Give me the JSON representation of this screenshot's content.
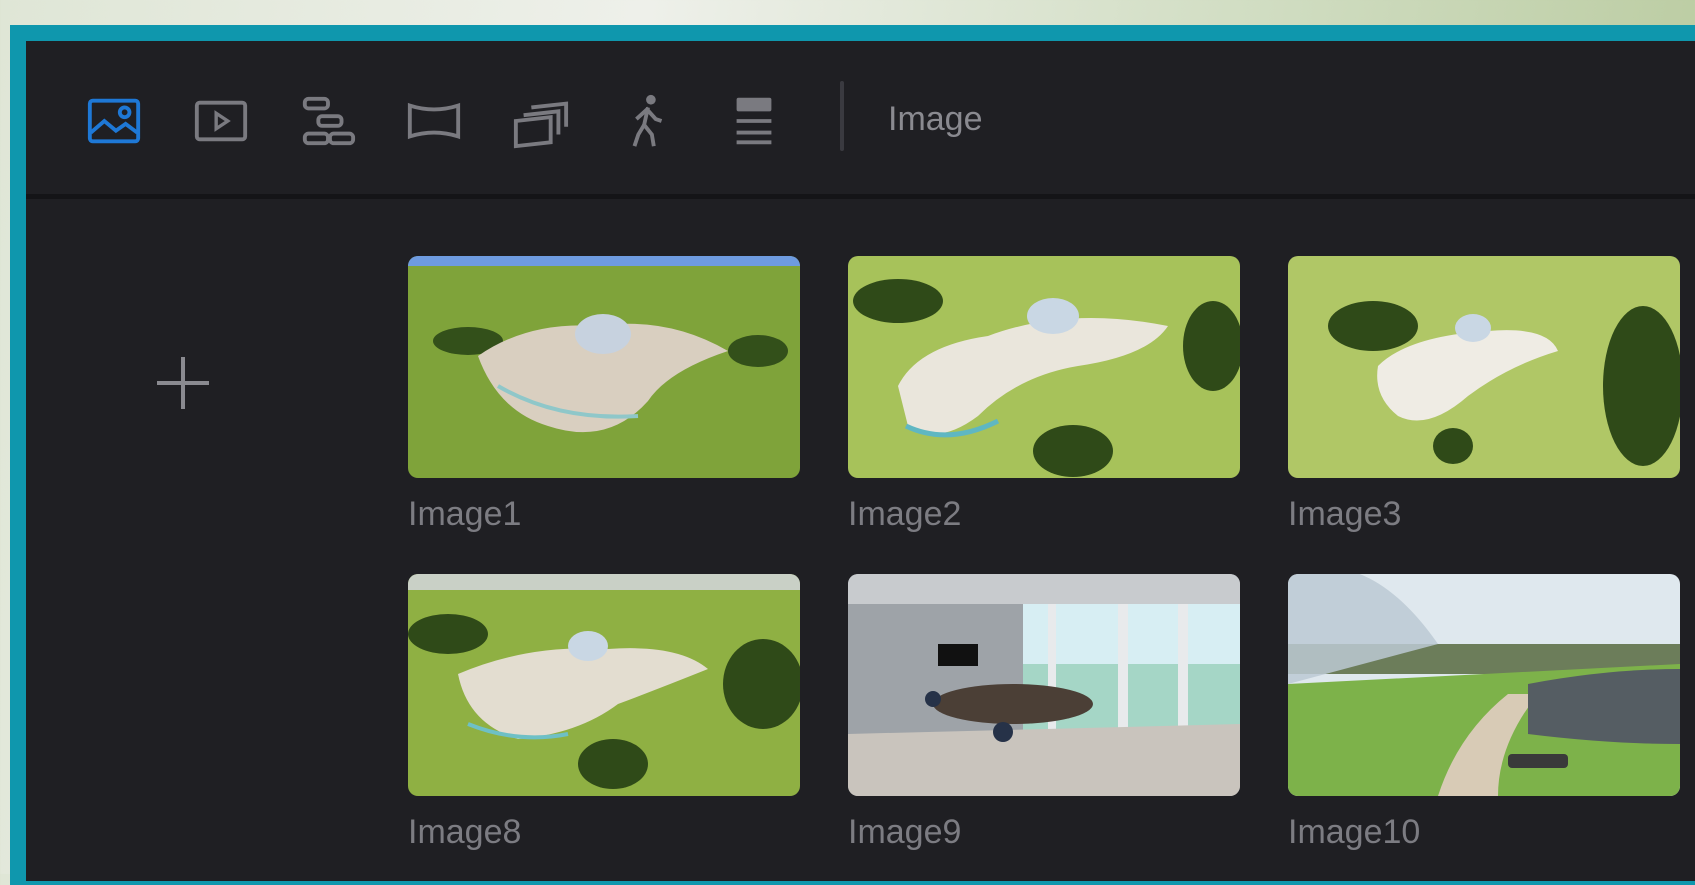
{
  "toolbar": {
    "tools": [
      {
        "icon": "image-icon",
        "active": true
      },
      {
        "icon": "video-icon",
        "active": false
      },
      {
        "icon": "flow-icon",
        "active": false
      },
      {
        "icon": "panorama-icon",
        "active": false
      },
      {
        "icon": "gallery-icon",
        "active": false
      },
      {
        "icon": "walk-icon",
        "active": false
      },
      {
        "icon": "layers-icon",
        "active": false
      }
    ],
    "mode_title": "Image"
  },
  "gallery": {
    "add_icon": "plus-icon",
    "items": [
      {
        "label": "Image1",
        "scene": "aerial"
      },
      {
        "label": "Image2",
        "scene": "aerial"
      },
      {
        "label": "Image3",
        "scene": "aerial"
      },
      {
        "label": "Image8",
        "scene": "aerial"
      },
      {
        "label": "Image9",
        "scene": "interior"
      },
      {
        "label": "Image10",
        "scene": "courtyard"
      }
    ]
  },
  "colors": {
    "accent": "#1e78d6",
    "icon_inactive": "#7a7a80",
    "panel": "#1f1f23",
    "frame": "#0f97ad"
  }
}
